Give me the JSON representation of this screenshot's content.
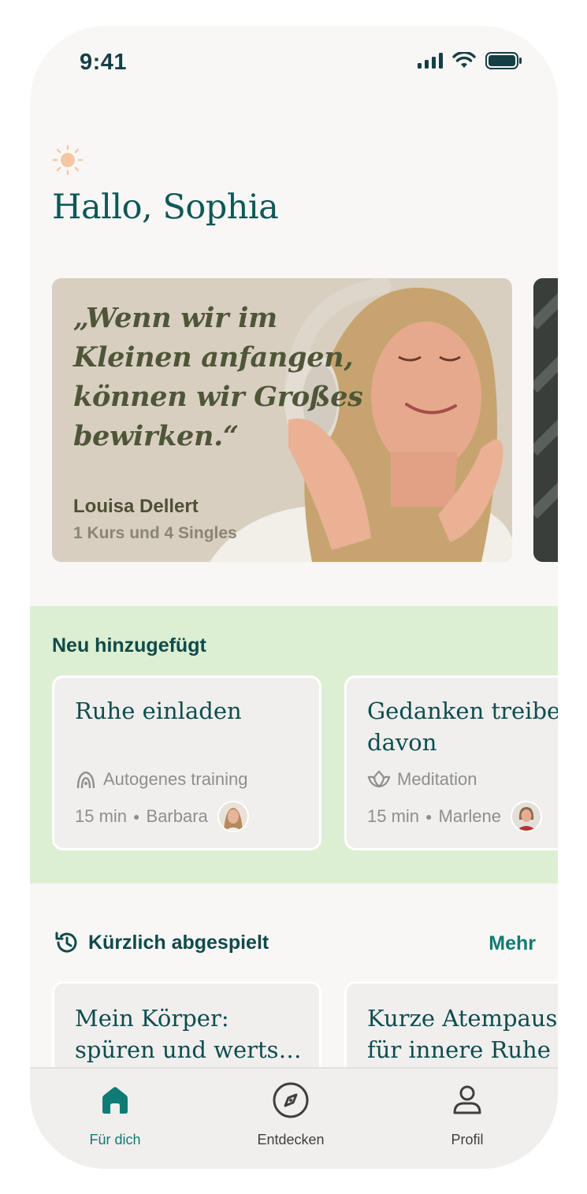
{
  "status_bar": {
    "time": "9:41"
  },
  "greeting": "Hallo, Sophia",
  "featured": {
    "quote": "„Wenn wir im Kleinen anfangen, können wir Großes bewirken.“",
    "author": "Louisa Dellert",
    "meta": "1 Kurs und 4 Singles"
  },
  "new_section": {
    "title": "Neu hinzugefügt",
    "cards": [
      {
        "title": "Ruhe einladen",
        "category": "Autogenes training",
        "category_icon": "autogenic-training-icon",
        "duration": "15 min",
        "teacher": "Barbara"
      },
      {
        "title": "Gedanken treiben davon",
        "title_line1": "Gedanken treibe",
        "title_line2": "davon",
        "category": "Meditation",
        "category_icon": "lotus-icon",
        "duration": "15 min",
        "teacher": "Marlene"
      }
    ]
  },
  "recent": {
    "title": "Kürzlich abgespielt",
    "more": "Mehr",
    "cards": [
      {
        "title": "Mein Körper: spüren und werts…"
      },
      {
        "title": "Kurze Atempaus für innere Ruhe"
      }
    ]
  },
  "tabs": [
    {
      "label": "Für dich",
      "icon": "home-icon",
      "active": true
    },
    {
      "label": "Entdecken",
      "icon": "compass-icon",
      "active": false
    },
    {
      "label": "Profil",
      "icon": "profile-icon",
      "active": false
    }
  ],
  "colors": {
    "accent": "#0e7c75",
    "heading": "#0e5856",
    "new_section_bg": "#dcefd2"
  }
}
